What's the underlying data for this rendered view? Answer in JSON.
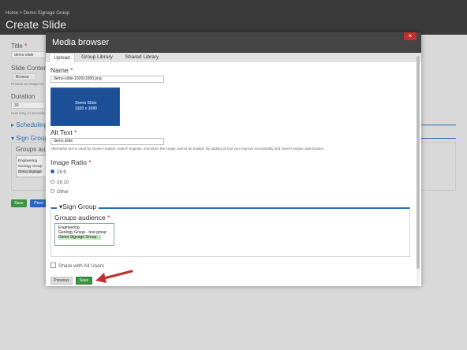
{
  "background": {
    "breadcrumb": "Home > Demo Signage Group",
    "page_title": "Create Slide",
    "title_label": "Title",
    "title_value": "demo-slide",
    "slide_content_label": "Slide Content",
    "browse_label": "Browse",
    "provide_text": "Provide an image for",
    "duration_label": "Duration",
    "duration_value": "30",
    "duration_help": "How long, in seconds",
    "scheduling_label": "Scheduling",
    "sign_group_label": "Sign Group",
    "groups_label": "Groups au",
    "groups": [
      "Engineering",
      "Geology Group",
      "Demo Signage"
    ],
    "save_label": "Save",
    "preview_label": "Previ"
  },
  "modal": {
    "title": "Media browser",
    "close_label": "×",
    "tabs": [
      "Upload",
      "Group Library",
      "Shared Library"
    ],
    "name_label": "Name",
    "name_value": "demo-slide-1920x1080.png",
    "preview_line1": "Demo Slide",
    "preview_line2": "1920  x  1080",
    "alt_label": "Alt Text",
    "alt_value": "demo slide",
    "alt_help": "Alternative text is used by screen readers, search engines, and when the image cannot be loaded. By adding alt text you improve accessibility and search engine optimization.",
    "ratio_label": "Image Ratio",
    "ratio_options": [
      "16:9",
      "16:10",
      "Other"
    ],
    "sign_group_legend": "Sign Group",
    "groups_audience_label": "Groups audience",
    "groups": [
      "Engineering",
      "Geology Group - test-group",
      "Demo Signage Group"
    ],
    "share_label": "Share with All Users",
    "previous_label": "Previous",
    "save_label": "Save"
  },
  "colors": {
    "modal_header": "#444444",
    "save_button": "#3a9440",
    "accent_blue": "#2d6db5",
    "arrow_red": "#c0302f"
  },
  "icons": [
    "close-icon",
    "triangle-down-icon",
    "red-arrow-icon"
  ]
}
